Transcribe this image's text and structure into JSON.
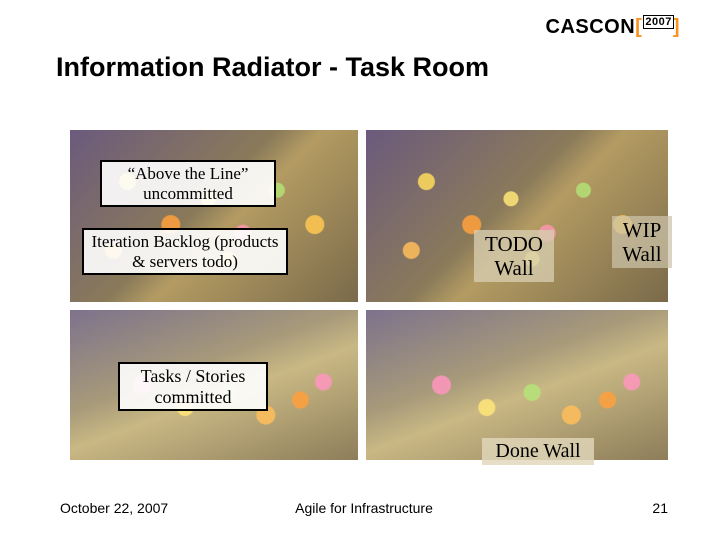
{
  "logo": {
    "brand": "CASCON",
    "year": "2007"
  },
  "title": "Information Radiator - Task Room",
  "callouts": {
    "above": "“Above the Line” uncommitted",
    "backlog": "Iteration Backlog (products & servers todo)",
    "todo": "TODO Wall",
    "wip": "WIP Wall",
    "tasks": "Tasks / Stories committed",
    "done": "Done Wall"
  },
  "footer": {
    "date": "October 22, 2007",
    "center": "Agile for Infrastructure",
    "page": "21"
  }
}
